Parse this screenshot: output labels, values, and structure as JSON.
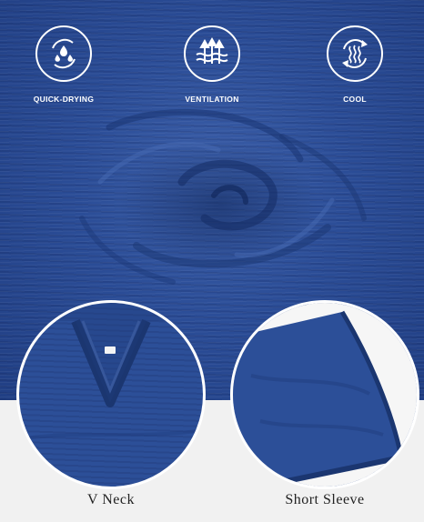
{
  "features": [
    {
      "label": "QUICK-DRYING",
      "icon": "water-drops-icon"
    },
    {
      "label": "VENTILATION",
      "icon": "airflow-arrows-icon"
    },
    {
      "label": "COOL",
      "icon": "cooling-cycle-icon"
    }
  ],
  "details": [
    {
      "caption": "V Neck"
    },
    {
      "caption": "Short Sleeve"
    }
  ],
  "colors": {
    "fabric": "#2b4d97",
    "panel": "#f1f1f1",
    "icon_stroke": "#ffffff",
    "caption_text": "#222222"
  }
}
